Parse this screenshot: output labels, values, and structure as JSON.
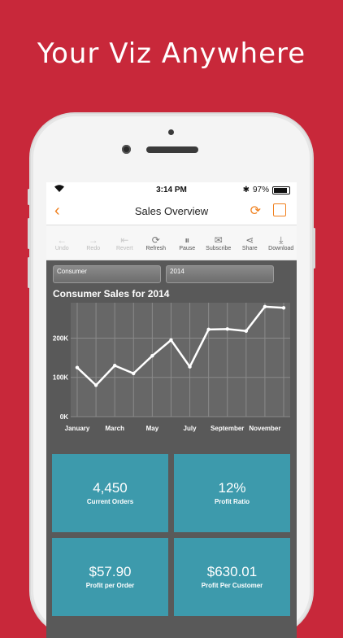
{
  "headline": "Your Viz Anywhere",
  "status_bar": {
    "time": "3:14 PM",
    "battery": "97%"
  },
  "nav": {
    "title": "Sales Overview"
  },
  "toolbar": [
    {
      "label": "Undo",
      "icon": "undo-icon",
      "glyph": "←",
      "enabled": false
    },
    {
      "label": "Redo",
      "icon": "redo-icon",
      "glyph": "→",
      "enabled": false
    },
    {
      "label": "Revert",
      "icon": "revert-icon",
      "glyph": "⇤",
      "enabled": false
    },
    {
      "label": "Refresh",
      "icon": "refresh-icon",
      "glyph": "⟳",
      "enabled": true
    },
    {
      "label": "Pause",
      "icon": "pause-icon",
      "glyph": "⏸",
      "enabled": true
    },
    {
      "label": "Subscribe",
      "icon": "subscribe-icon",
      "glyph": "✉",
      "enabled": true
    },
    {
      "label": "Share",
      "icon": "share-icon",
      "glyph": "⋖",
      "enabled": true
    },
    {
      "label": "Download",
      "icon": "download-icon",
      "glyph": "⤓",
      "enabled": true
    }
  ],
  "filters": {
    "segment": "Consumer",
    "year": "2014"
  },
  "chart_data": {
    "type": "line",
    "title": "Consumer Sales for 2014",
    "x_tick_labels": [
      "January",
      "March",
      "May",
      "July",
      "September",
      "November"
    ],
    "y_tick_labels": [
      "0K",
      "100K",
      "200K"
    ],
    "ylim": [
      0,
      290000
    ],
    "grid": true,
    "series": [
      {
        "values": [
          125000,
          80000,
          130000,
          110000,
          155000,
          195000,
          127000,
          222000,
          223000,
          218000,
          280000,
          277000
        ]
      }
    ]
  },
  "kpis": [
    {
      "value": "4,450",
      "label": "Current Orders"
    },
    {
      "value": "12%",
      "label": "Profit Ratio"
    },
    {
      "value": "$57.90",
      "label": "Profit per Order"
    },
    {
      "value": "$630.01",
      "label": "Profit Per Customer"
    }
  ],
  "colors": {
    "brand_red": "#c8283a",
    "accent_orange": "#f0801e",
    "kpi_teal": "#3d9aac",
    "viz_bg": "#595959"
  }
}
